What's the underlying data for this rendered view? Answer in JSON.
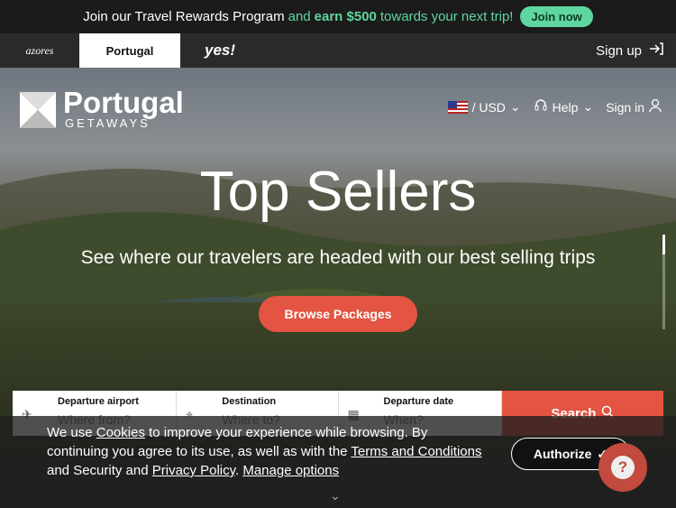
{
  "promo": {
    "text1": "Join our Travel Rewards Program",
    "text2": "and",
    "text3": "earn $500",
    "text4": "towards your next trip!",
    "join_label": "Join now",
    "accent": "#5fd6a0"
  },
  "brands": {
    "azores": "azores",
    "portugal": "Portugal",
    "yes": "yes!"
  },
  "signup_label": "Sign up",
  "hero": {
    "logo_name": "Portugal",
    "logo_sub": "GETAWAYS",
    "currency": "/ USD",
    "help": "Help",
    "signin": "Sign in",
    "title": "Top Sellers",
    "subtitle": "See where our travelers are headed with our best selling trips",
    "browse_label": "Browse Packages",
    "accent": "#e35442"
  },
  "search": {
    "departure_label": "Departure airport",
    "departure_placeholder": "Where from?",
    "destination_label": "Destination",
    "destination_placeholder": "Where to?",
    "date_label": "Departure date",
    "date_placeholder": "When?",
    "button_label": "Search"
  },
  "cookie": {
    "t1": "We use ",
    "cookies_link": "Cookies",
    "t2": " to improve your experience while browsing. By continuing you agree to its use, as well as with the ",
    "terms_link": "Terms and Conditions",
    "t3": " and Security and ",
    "privacy_link": "Privacy Policy",
    "t4": ". ",
    "manage_link": "Manage options",
    "authorize_label": "Authorize"
  },
  "icons": {
    "signup": "sign-in-arrow-icon",
    "help": "headset-icon",
    "user": "user-icon",
    "plane": "plane-icon",
    "pin": "location-pin-icon",
    "calendar": "calendar-icon",
    "search": "search-icon",
    "check": "check-icon"
  }
}
